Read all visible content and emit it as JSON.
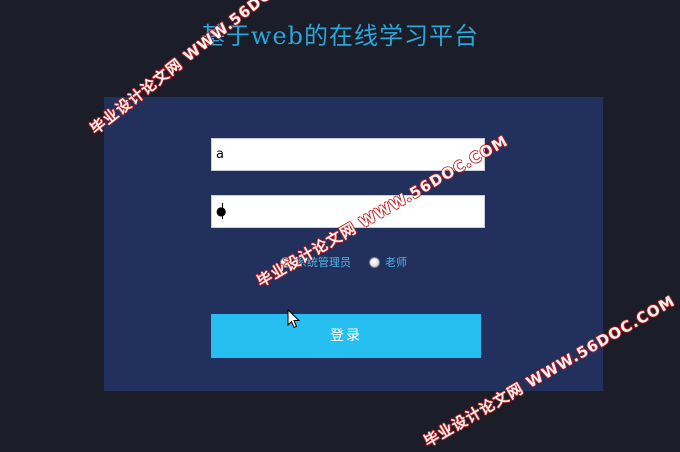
{
  "page": {
    "title": "基于web的在线学习平台"
  },
  "login": {
    "username_value": "a",
    "password_mask": "●",
    "roles": [
      {
        "label": "系统管理员"
      },
      {
        "label": "老师"
      }
    ],
    "submit_label": "登录"
  },
  "watermarks": [
    "毕业设计论文网 WWW.56DOC.COM",
    "毕业设计论文网 WWW.56DOC.COM",
    "毕业设计论文网 WWW.56DOC.COM"
  ],
  "colors": {
    "page_background": "#1b1e28",
    "panel_background": "#22305d",
    "title_color": "#29a6da",
    "button_background": "#27bff2",
    "role_text": "#4fb4e8",
    "watermark_outline": "#c11a1a"
  }
}
